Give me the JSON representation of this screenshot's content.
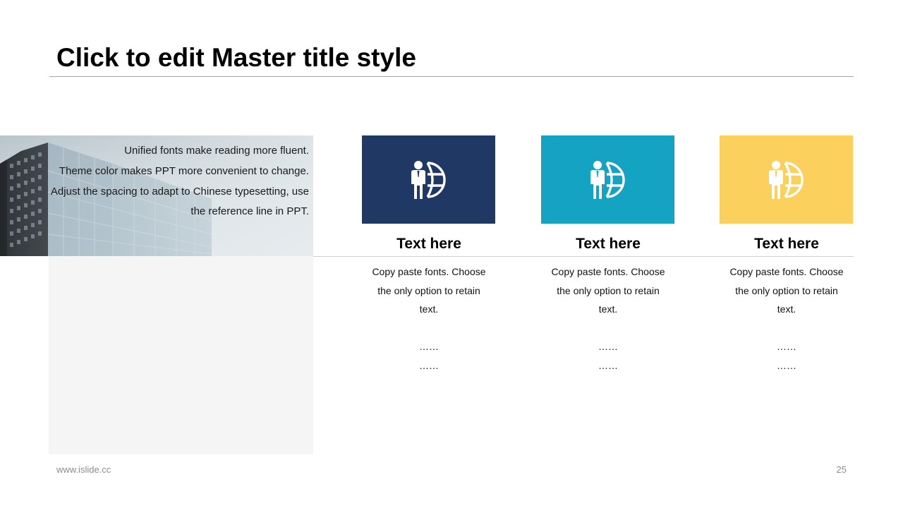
{
  "slide": {
    "title": "Click to edit Master title style",
    "footer_url": "www.islide.cc",
    "page_number": "25"
  },
  "intro": {
    "lines": [
      "Unified fonts make reading more fluent.",
      "Theme color makes PPT more convenient to change.",
      "Adjust the spacing to adapt to Chinese typesetting, use the reference line in PPT."
    ]
  },
  "cards": [
    {
      "color": "#203864",
      "icon": "businessman-globe-icon",
      "heading": "Text here",
      "body": "Copy paste fonts. Choose the only option to retain text.",
      "dots1": "……",
      "dots2": "……"
    },
    {
      "color": "#14a3c2",
      "icon": "businessman-globe-icon",
      "heading": "Text here",
      "body": "Copy paste fonts. Choose the only option to retain text.",
      "dots1": "……",
      "dots2": "……"
    },
    {
      "color": "#fcd05c",
      "icon": "businessman-globe-icon",
      "heading": "Text here",
      "body": "Copy paste fonts. Choose the only option to retain text.",
      "dots1": "……",
      "dots2": "……"
    }
  ]
}
